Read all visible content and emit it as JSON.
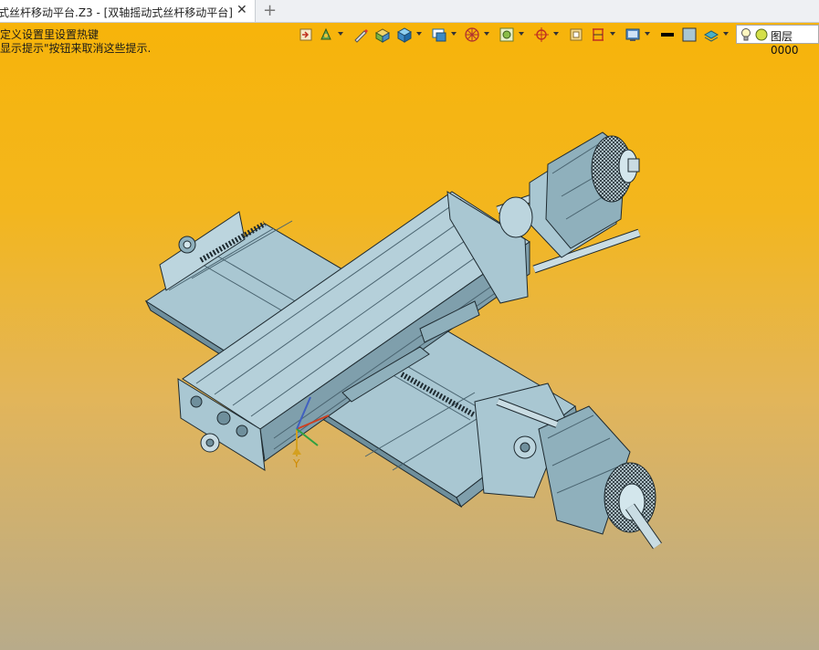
{
  "tab": {
    "title": "式丝杆移动平台.Z3 - [双轴摇动式丝杆移动平台]",
    "close_glyph": "✕",
    "new_tab_glyph": "+"
  },
  "hints": {
    "line1": "定义设置里设置热键",
    "line2": "显示提示\"按钮来取消这些提示."
  },
  "toolbar": {
    "icons": [
      "view-icon",
      "pan-icon",
      "sketch-icon",
      "box-shade-icon",
      "cube-icon",
      "display-mode-icon",
      "wheel-icon",
      "filter-icon",
      "snap-icon",
      "frame-icon",
      "dimension-icon",
      "render-icon",
      "line-color-icon",
      "face-color-icon",
      "layer-icon"
    ],
    "layer_name": "图层0000"
  },
  "axis": {
    "y_label": "Y"
  },
  "colors": {
    "part": "#a9c7d2",
    "part_dark": "#6f8f9c",
    "part_light": "#d3e6ec",
    "edge": "#1e2a30"
  }
}
